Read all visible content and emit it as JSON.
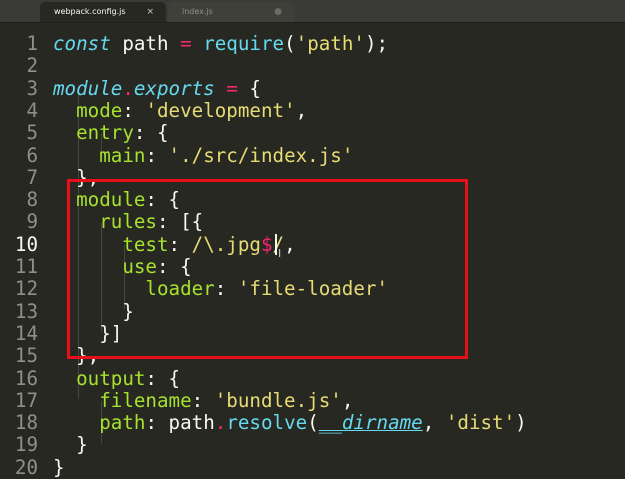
{
  "tabs": [
    {
      "label": "webpack.config.js",
      "active": true,
      "close_icon": "×"
    },
    {
      "label": "index.js",
      "active": false,
      "close_icon": "●"
    }
  ],
  "editor": {
    "language": "javascript",
    "current_line": 10,
    "lines": [
      {
        "num": "1",
        "tokens": [
          {
            "t": "const",
            "c": "kw"
          },
          {
            "t": " path ",
            "c": "plain"
          },
          {
            "t": "=",
            "c": "op"
          },
          {
            "t": " ",
            "c": "plain"
          },
          {
            "t": "require",
            "c": "fn"
          },
          {
            "t": "(",
            "c": "punc"
          },
          {
            "t": "'path'",
            "c": "str"
          },
          {
            "t": ");",
            "c": "punc"
          }
        ]
      },
      {
        "num": "2",
        "tokens": []
      },
      {
        "num": "3",
        "tokens": [
          {
            "t": "module",
            "c": "kw"
          },
          {
            "t": ".",
            "c": "op"
          },
          {
            "t": "exports",
            "c": "kw"
          },
          {
            "t": " ",
            "c": "plain"
          },
          {
            "t": "=",
            "c": "op"
          },
          {
            "t": " {",
            "c": "punc"
          }
        ]
      },
      {
        "num": "4",
        "tokens": [
          {
            "t": "  ",
            "c": "plain"
          },
          {
            "t": "mode",
            "c": "prop"
          },
          {
            "t": ": ",
            "c": "punc"
          },
          {
            "t": "'development'",
            "c": "str"
          },
          {
            "t": ",",
            "c": "punc"
          }
        ]
      },
      {
        "num": "5",
        "tokens": [
          {
            "t": "  ",
            "c": "plain"
          },
          {
            "t": "entry",
            "c": "prop"
          },
          {
            "t": ": {",
            "c": "punc"
          }
        ]
      },
      {
        "num": "6",
        "tokens": [
          {
            "t": "    ",
            "c": "plain"
          },
          {
            "t": "main",
            "c": "prop"
          },
          {
            "t": ": ",
            "c": "punc"
          },
          {
            "t": "'./src/index.js'",
            "c": "str"
          }
        ]
      },
      {
        "num": "7",
        "tokens": [
          {
            "t": "  },",
            "c": "punc"
          }
        ]
      },
      {
        "num": "8",
        "tokens": [
          {
            "t": "  ",
            "c": "plain"
          },
          {
            "t": "module",
            "c": "prop"
          },
          {
            "t": ": {",
            "c": "punc"
          }
        ]
      },
      {
        "num": "9",
        "tokens": [
          {
            "t": "    ",
            "c": "plain"
          },
          {
            "t": "rules",
            "c": "prop"
          },
          {
            "t": ": [{",
            "c": "punc"
          }
        ]
      },
      {
        "num": "10",
        "tokens": [
          {
            "t": "      ",
            "c": "plain"
          },
          {
            "t": "test",
            "c": "prop"
          },
          {
            "t": ": ",
            "c": "punc"
          },
          {
            "t": "/\\.jpg",
            "c": "str"
          },
          {
            "t": "$",
            "c": "op"
          },
          {
            "t": "/",
            "c": "str"
          },
          {
            "t": ",",
            "c": "punc"
          }
        ]
      },
      {
        "num": "11",
        "tokens": [
          {
            "t": "      ",
            "c": "plain"
          },
          {
            "t": "use",
            "c": "prop"
          },
          {
            "t": ": {",
            "c": "punc"
          }
        ]
      },
      {
        "num": "12",
        "tokens": [
          {
            "t": "        ",
            "c": "plain"
          },
          {
            "t": "loader",
            "c": "prop"
          },
          {
            "t": ": ",
            "c": "punc"
          },
          {
            "t": "'file-loader'",
            "c": "str"
          }
        ]
      },
      {
        "num": "13",
        "tokens": [
          {
            "t": "      }",
            "c": "punc"
          }
        ]
      },
      {
        "num": "14",
        "tokens": [
          {
            "t": "    }]",
            "c": "punc"
          }
        ]
      },
      {
        "num": "15",
        "tokens": [
          {
            "t": "  },",
            "c": "punc"
          }
        ]
      },
      {
        "num": "16",
        "tokens": [
          {
            "t": "  ",
            "c": "plain"
          },
          {
            "t": "output",
            "c": "prop"
          },
          {
            "t": ": {",
            "c": "punc"
          }
        ]
      },
      {
        "num": "17",
        "tokens": [
          {
            "t": "    ",
            "c": "plain"
          },
          {
            "t": "filename",
            "c": "prop"
          },
          {
            "t": ": ",
            "c": "punc"
          },
          {
            "t": "'bundle.js'",
            "c": "str"
          },
          {
            "t": ",",
            "c": "punc"
          }
        ]
      },
      {
        "num": "18",
        "tokens": [
          {
            "t": "    ",
            "c": "plain"
          },
          {
            "t": "path",
            "c": "prop"
          },
          {
            "t": ": ",
            "c": "punc"
          },
          {
            "t": "path",
            "c": "plain"
          },
          {
            "t": ".",
            "c": "op"
          },
          {
            "t": "resolve",
            "c": "fn"
          },
          {
            "t": "(",
            "c": "punc"
          },
          {
            "t": "__dirname",
            "c": "it-var"
          },
          {
            "t": ", ",
            "c": "punc"
          },
          {
            "t": "'dist'",
            "c": "str"
          },
          {
            "t": ")",
            "c": "punc"
          }
        ]
      },
      {
        "num": "19",
        "tokens": [
          {
            "t": "  }",
            "c": "punc"
          }
        ]
      },
      {
        "num": "20",
        "tokens": [
          {
            "t": "}",
            "c": "punc"
          }
        ]
      }
    ]
  },
  "colors": {
    "background": "#272822",
    "highlight_box": "#e7101a",
    "keyword": "#66d9ef",
    "string": "#e6db74",
    "property": "#a6e22e",
    "operator": "#f92672"
  }
}
